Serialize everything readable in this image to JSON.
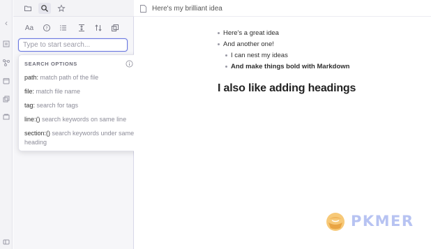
{
  "ribbon": {
    "icons": [
      "chevron-left-icon",
      "file-explorer-icon",
      "graph-icon",
      "calendar-icon",
      "copy-icon",
      "slides-icon",
      "help-icon"
    ]
  },
  "sidepanel": {
    "tabs": [
      "folder-icon",
      "search-icon",
      "star-icon"
    ],
    "search_options": {
      "match_case_label": "Aa"
    },
    "search": {
      "placeholder": "Type to start search..."
    },
    "popup": {
      "title": "SEARCH OPTIONS",
      "items": [
        {
          "key": "path:",
          "desc": " match path of the file"
        },
        {
          "key": "file:",
          "desc": " match file name"
        },
        {
          "key": "tag:",
          "desc": " search for tags"
        },
        {
          "key": "line:()",
          "desc": " search keywords on same line"
        },
        {
          "key": "section:()",
          "desc": " search keywords under same heading"
        }
      ]
    }
  },
  "main": {
    "doc_title": "Here's my brilliant idea",
    "bullets": [
      {
        "text": "Here's a great idea",
        "level": 0,
        "bold": false
      },
      {
        "text": "And another one!",
        "level": 0,
        "bold": false
      },
      {
        "text": "I can nest my ideas",
        "level": 1,
        "bold": false
      },
      {
        "text": "And make things bold with Markdown",
        "level": 1,
        "bold": true
      }
    ],
    "heading": "I also like adding headings"
  },
  "watermark": {
    "text": "PKMER"
  },
  "colors": {
    "accent": "#6b79e0",
    "watermark": "#b7c3f2",
    "watermark_logo": "#f0b45a"
  }
}
